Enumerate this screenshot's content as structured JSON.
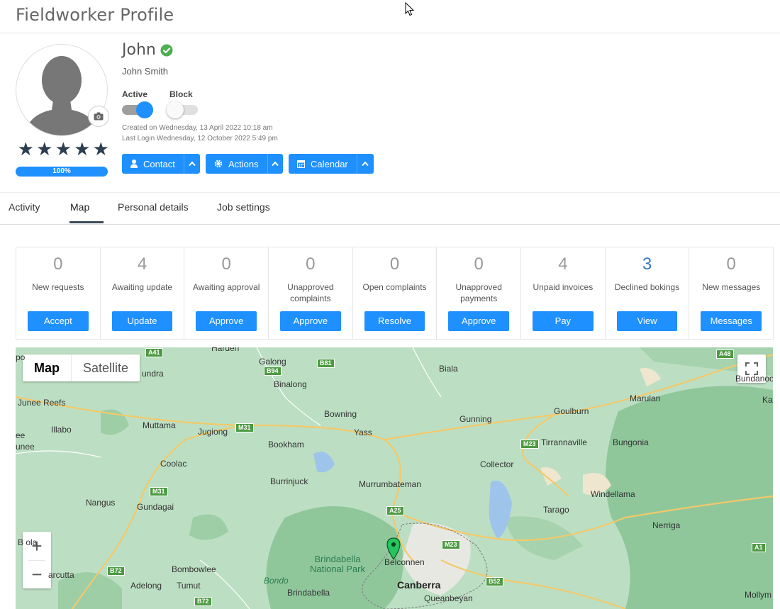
{
  "header": {
    "title": "Fieldworker Profile"
  },
  "profile": {
    "display_name": "John",
    "full_name": "John Smith",
    "rating_stars": 5,
    "profile_completion": "100%",
    "active_label": "Active",
    "block_label": "Block",
    "active_on": true,
    "block_on": false,
    "created": "Created on Wednesday, 13 April 2022 10:18 am",
    "last_login": "Last Login Wednesday, 12 October 2022 5:49 pm",
    "buttons": {
      "contact": "Contact",
      "actions": "Actions",
      "calendar": "Calendar"
    }
  },
  "tabs": [
    "Activity",
    "Map",
    "Personal details",
    "Job settings"
  ],
  "active_tab": "Map",
  "cards": [
    {
      "count": "0",
      "label": "New requests",
      "action": "Accept"
    },
    {
      "count": "4",
      "label": "Awaiting update",
      "action": "Update"
    },
    {
      "count": "0",
      "label": "Awaiting approval",
      "action": "Approve"
    },
    {
      "count": "0",
      "label": "Unapproved complaints",
      "action": "Approve"
    },
    {
      "count": "0",
      "label": "Open complaints",
      "action": "Resolve"
    },
    {
      "count": "0",
      "label": "Unapproved payments",
      "action": "Approve"
    },
    {
      "count": "4",
      "label": "Unpaid invoices",
      "action": "Pay"
    },
    {
      "count": "3",
      "label": "Declined bokings",
      "action": "View"
    },
    {
      "count": "0",
      "label": "New messages",
      "action": "Messages"
    }
  ],
  "map": {
    "type_map": "Map",
    "type_satellite": "Satellite",
    "places": {
      "harden": "Harden",
      "galong": "Galong",
      "biala": "Biala",
      "bundanoon": "Bundanoo",
      "gundra": "undra",
      "binalong": "Binalong",
      "junee_reefs": "Junee Reefs",
      "bowning": "Bowning",
      "gunning": "Gunning",
      "goulburn": "Goulburn",
      "marulan": "Marulan",
      "illabo": "Illabo",
      "muttama": "Muttama",
      "jugiong": "Jugiong",
      "yass": "Yass",
      "bookham": "Bookham",
      "tirrannaville": "Tirrannaville",
      "bungonia": "Bungonia",
      "junee": "unee",
      "coolac": "Coolac",
      "collector": "Collector",
      "burrinjuck": "Burrinjuck",
      "murrumbateman": "Murrumbateman",
      "windellama": "Windellama",
      "nangus": "Nangus",
      "gundagai": "Gundagai",
      "tarago": "Tarago",
      "nerriga": "Nerriga",
      "bola": "B   ola",
      "brindabella_np": "Brindabella National Park",
      "belconnen": "Belconnen",
      "bombowlee": "Bombowlee",
      "bondo": "Bondo",
      "canberra": "Canberra",
      "arcutta": "arcutta",
      "adelong": "Adelong",
      "tumut": "Tumut",
      "brindabella": "Brindabella",
      "queanbeyan": "Queanbeyan",
      "mollym": "Mollym",
      "ee": "ee",
      "po": "po",
      "ka": "Ka"
    },
    "shields": {
      "a41": "A41",
      "b94": "B94",
      "b81": "B81",
      "a48": "A48",
      "m31a": "M31",
      "m23a": "M23",
      "m31b": "M31",
      "a25": "A25",
      "m23b": "M23",
      "a1": "A1",
      "b72a": "B72",
      "b52": "B52",
      "b72b": "B72"
    }
  },
  "colors": {
    "accent": "#1e90ff",
    "verified": "#4caf50",
    "map_pin": "#22c55e"
  }
}
